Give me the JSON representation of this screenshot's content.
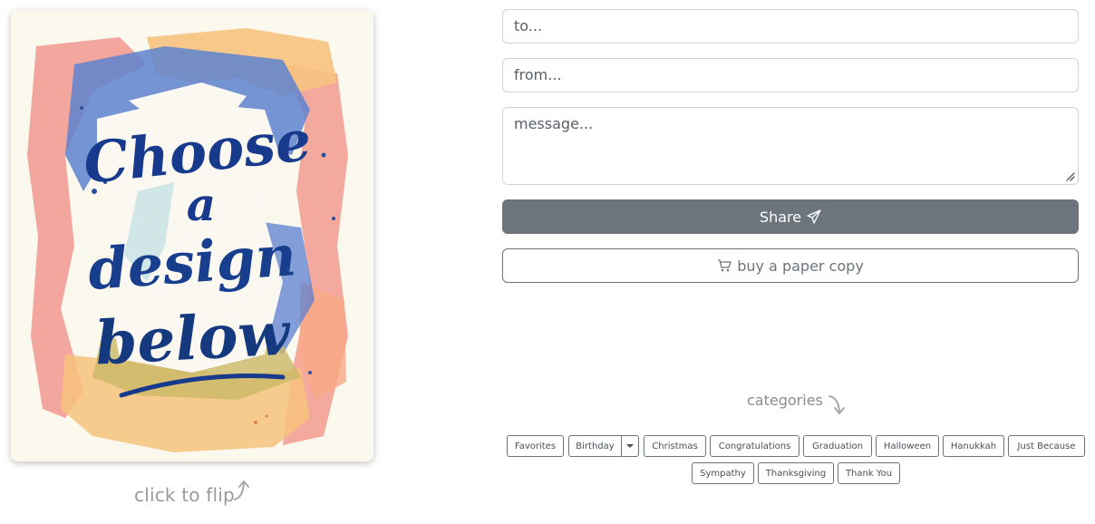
{
  "card": {
    "lines": [
      "Choose",
      "a",
      "design",
      "below"
    ],
    "flip_hint": "click to flip",
    "colors": {
      "ink": "#173a8c",
      "pink": "#f19a93",
      "peach": "#f7bf7e",
      "blue": "#5f83cf",
      "olive": "#c9b766"
    }
  },
  "form": {
    "to_placeholder": "to...",
    "from_placeholder": "from...",
    "message_placeholder": "message...",
    "share_label": "Share",
    "buy_label": "buy a paper copy"
  },
  "categories": {
    "title": "categories",
    "items": [
      "Favorites",
      "Birthday",
      "Christmas",
      "Congratulations",
      "Graduation",
      "Halloween",
      "Hanukkah",
      "Just Because",
      "Sympathy",
      "Thanksgiving",
      "Thank You"
    ]
  },
  "icons": {
    "share": "paper-plane-icon",
    "buy": "cart-icon",
    "birthday_dropdown": "caret-down-icon"
  }
}
